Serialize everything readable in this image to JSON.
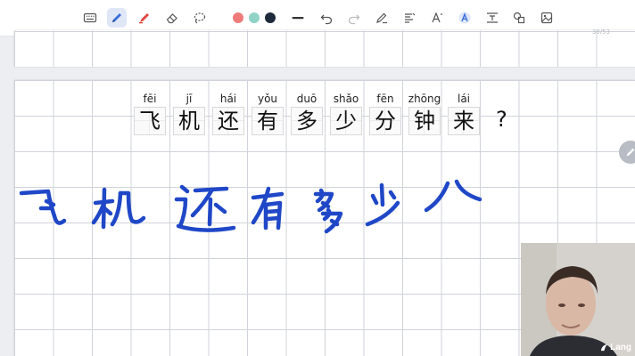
{
  "toolbar": {
    "tools": [
      {
        "name": "keyboard-icon",
        "active": false
      },
      {
        "name": "pen-icon",
        "active": true
      },
      {
        "name": "highlighter-icon",
        "active": false
      },
      {
        "name": "eraser-icon",
        "active": false
      },
      {
        "name": "lasso-icon",
        "active": false
      }
    ],
    "colors": [
      "#ee7b79",
      "#8fd3c6",
      "#1d2b3a"
    ],
    "actions": [
      "stroke-width-icon",
      "undo-icon",
      "redo-icon",
      "pen-settings-icon",
      "shapes-icon",
      "text-tool-icon",
      "ai-text-icon",
      "insert-text-icon",
      "shape-tool-icon",
      "image-icon"
    ]
  },
  "page": {
    "counter": "38/53",
    "sentence": [
      {
        "pinyin": "fēi",
        "hanzi": "飞"
      },
      {
        "pinyin": "jī",
        "hanzi": "机"
      },
      {
        "pinyin": "hái",
        "hanzi": "还"
      },
      {
        "pinyin": "yǒu",
        "hanzi": "有"
      },
      {
        "pinyin": "duō",
        "hanzi": "多"
      },
      {
        "pinyin": "shǎo",
        "hanzi": "少"
      },
      {
        "pinyin": "fēn",
        "hanzi": "分"
      },
      {
        "pinyin": "zhōng",
        "hanzi": "钟"
      },
      {
        "pinyin": "lái",
        "hanzi": "来"
      }
    ],
    "punctuation": "?",
    "ink_color": "#1f47c7"
  },
  "webcam": {
    "logo": "Lang"
  }
}
